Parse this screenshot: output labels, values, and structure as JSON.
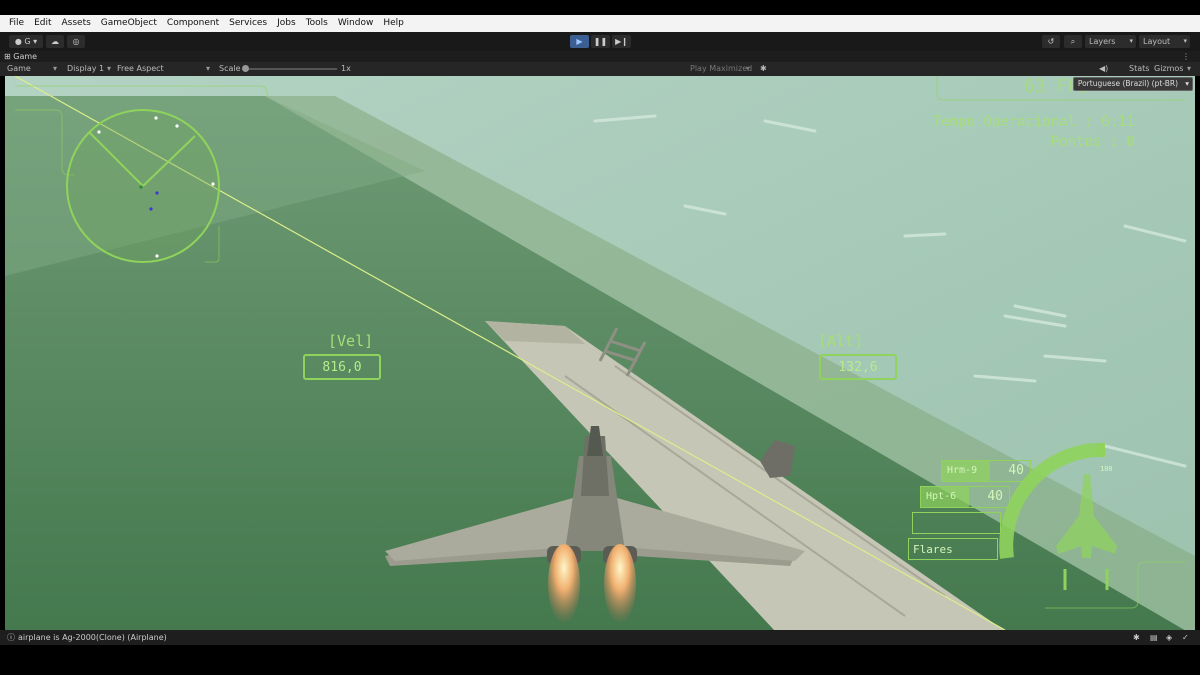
{
  "menu": [
    "File",
    "Edit",
    "Assets",
    "GameObject",
    "Component",
    "Services",
    "Jobs",
    "Tools",
    "Window",
    "Help"
  ],
  "toolbar": {
    "account_label": "G",
    "layers_label": "Layers",
    "layout_label": "Layout",
    "play_icon": "play-icon",
    "pause_icon": "pause-icon",
    "step_icon": "step-icon"
  },
  "tab": {
    "label": "Game"
  },
  "game_controls": {
    "view_mode": "Game",
    "display": "Display 1",
    "aspect": "Free Aspect",
    "scale_label": "Scale",
    "scale_value": "1x",
    "play_maximized": "Play Maximized",
    "stats": "Stats",
    "gizmos": "Gizmos",
    "language": "Portuguese (Brazil) (pt-BR)"
  },
  "hud": {
    "fps": "63 FPS",
    "tempo": "Tempo Operacional : 0:11",
    "pontos": "Pontos : 0",
    "vel_label": "[Vel]",
    "vel_value": "816,0",
    "alt_label": "[Alt]",
    "alt_value": "132,6",
    "throttle_max": "100",
    "weapons": [
      {
        "name": "Hrm-9",
        "count": "40"
      },
      {
        "name": "Hpt-6",
        "count": "40"
      }
    ],
    "flares_label": "Flares"
  },
  "status": {
    "message": "airplane is Ag-2000(Clone) (Airplane)"
  },
  "colors": {
    "hud": "#8fd35c",
    "editor_dark": "#1e1e1e",
    "play_active": "#3c5f93"
  }
}
